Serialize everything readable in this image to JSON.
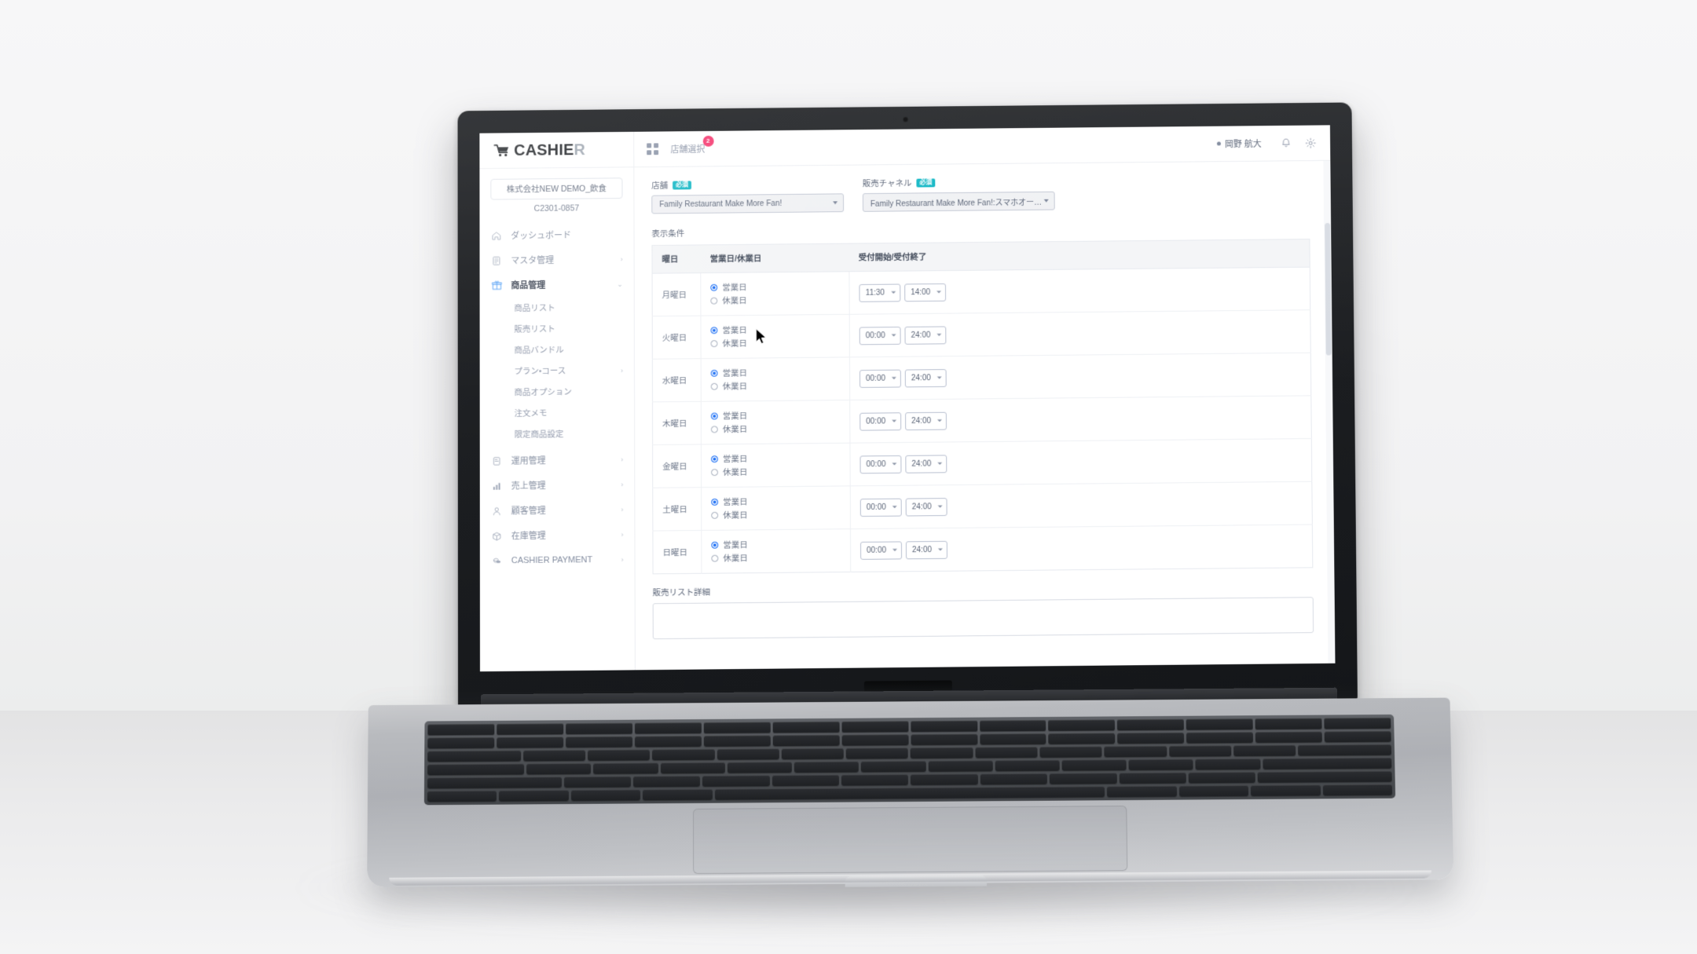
{
  "app": {
    "brand": {
      "text_main": "CASHIE",
      "text_accent": "R",
      "cart_icon": "shopping-cart-icon"
    },
    "topnav": {
      "grid_icon": "grid-apps-icon",
      "shop_select_label": "店舗選択",
      "shop_select_badge": "2"
    },
    "topright": {
      "user_name": "岡野 航大",
      "bell_icon": "notification-bell-icon",
      "gear_icon": "settings-gear-icon"
    }
  },
  "sidebar": {
    "company_name": "株式会社NEW DEMO_飲食",
    "company_code": "C2301-0857",
    "items": [
      {
        "label": "ダッシュボード",
        "icon": "home-icon",
        "chevron": "",
        "active": false
      },
      {
        "label": "マスタ管理",
        "icon": "book-icon",
        "chevron": "›",
        "active": false
      },
      {
        "label": "商品管理",
        "icon": "gift-icon",
        "chevron": "⌄",
        "active": true
      }
    ],
    "sub_items": [
      {
        "label": "商品リスト",
        "chevron": ""
      },
      {
        "label": "販売リスト",
        "chevron": ""
      },
      {
        "label": "商品バンドル",
        "chevron": ""
      },
      {
        "label": "プラン・コース",
        "chevron": "›"
      },
      {
        "label": "商品オプション",
        "chevron": ""
      },
      {
        "label": "注文メモ",
        "chevron": ""
      },
      {
        "label": "限定商品設定",
        "chevron": ""
      }
    ],
    "items_lower": [
      {
        "label": "運用管理",
        "icon": "clipboard-icon",
        "chevron": "›"
      },
      {
        "label": "売上管理",
        "icon": "bar-chart-icon",
        "chevron": "›"
      },
      {
        "label": "顧客管理",
        "icon": "user-icon",
        "chevron": "›"
      },
      {
        "label": "在庫管理",
        "icon": "box-icon",
        "chevron": "›"
      },
      {
        "label": "CASHIER PAYMENT",
        "icon": "coins-icon",
        "chevron": "›"
      }
    ]
  },
  "main": {
    "store_field": {
      "label": "店舗",
      "required_tag": "必須",
      "value": "Family Restaurant Make More Fan!"
    },
    "channel_field": {
      "label": "販売チャネル",
      "required_tag": "必須",
      "value": "Family Restaurant Make More Fan!:スマホオー…"
    },
    "section_title": "表示条件",
    "table": {
      "headers": [
        "曜日",
        "営業日/休業日",
        "受付開始/受付終了"
      ],
      "open_label": "営業日",
      "closed_label": "休業日",
      "rows": [
        {
          "day": "月曜日",
          "status": "open",
          "start": "11:30",
          "end": "14:00"
        },
        {
          "day": "火曜日",
          "status": "open",
          "start": "00:00",
          "end": "24:00"
        },
        {
          "day": "水曜日",
          "status": "open",
          "start": "00:00",
          "end": "24:00"
        },
        {
          "day": "木曜日",
          "status": "open",
          "start": "00:00",
          "end": "24:00"
        },
        {
          "day": "金曜日",
          "status": "open",
          "start": "00:00",
          "end": "24:00"
        },
        {
          "day": "土曜日",
          "status": "open",
          "start": "00:00",
          "end": "24:00"
        },
        {
          "day": "日曜日",
          "status": "open",
          "start": "00:00",
          "end": "24:00"
        }
      ]
    },
    "detail_label": "販売リスト詳細",
    "detail_value": ""
  },
  "colors": {
    "accent_teal": "#12b7c5",
    "accent_blue": "#1a6ef5",
    "badge_pink": "#f5376e",
    "text_muted": "#7d879b"
  }
}
